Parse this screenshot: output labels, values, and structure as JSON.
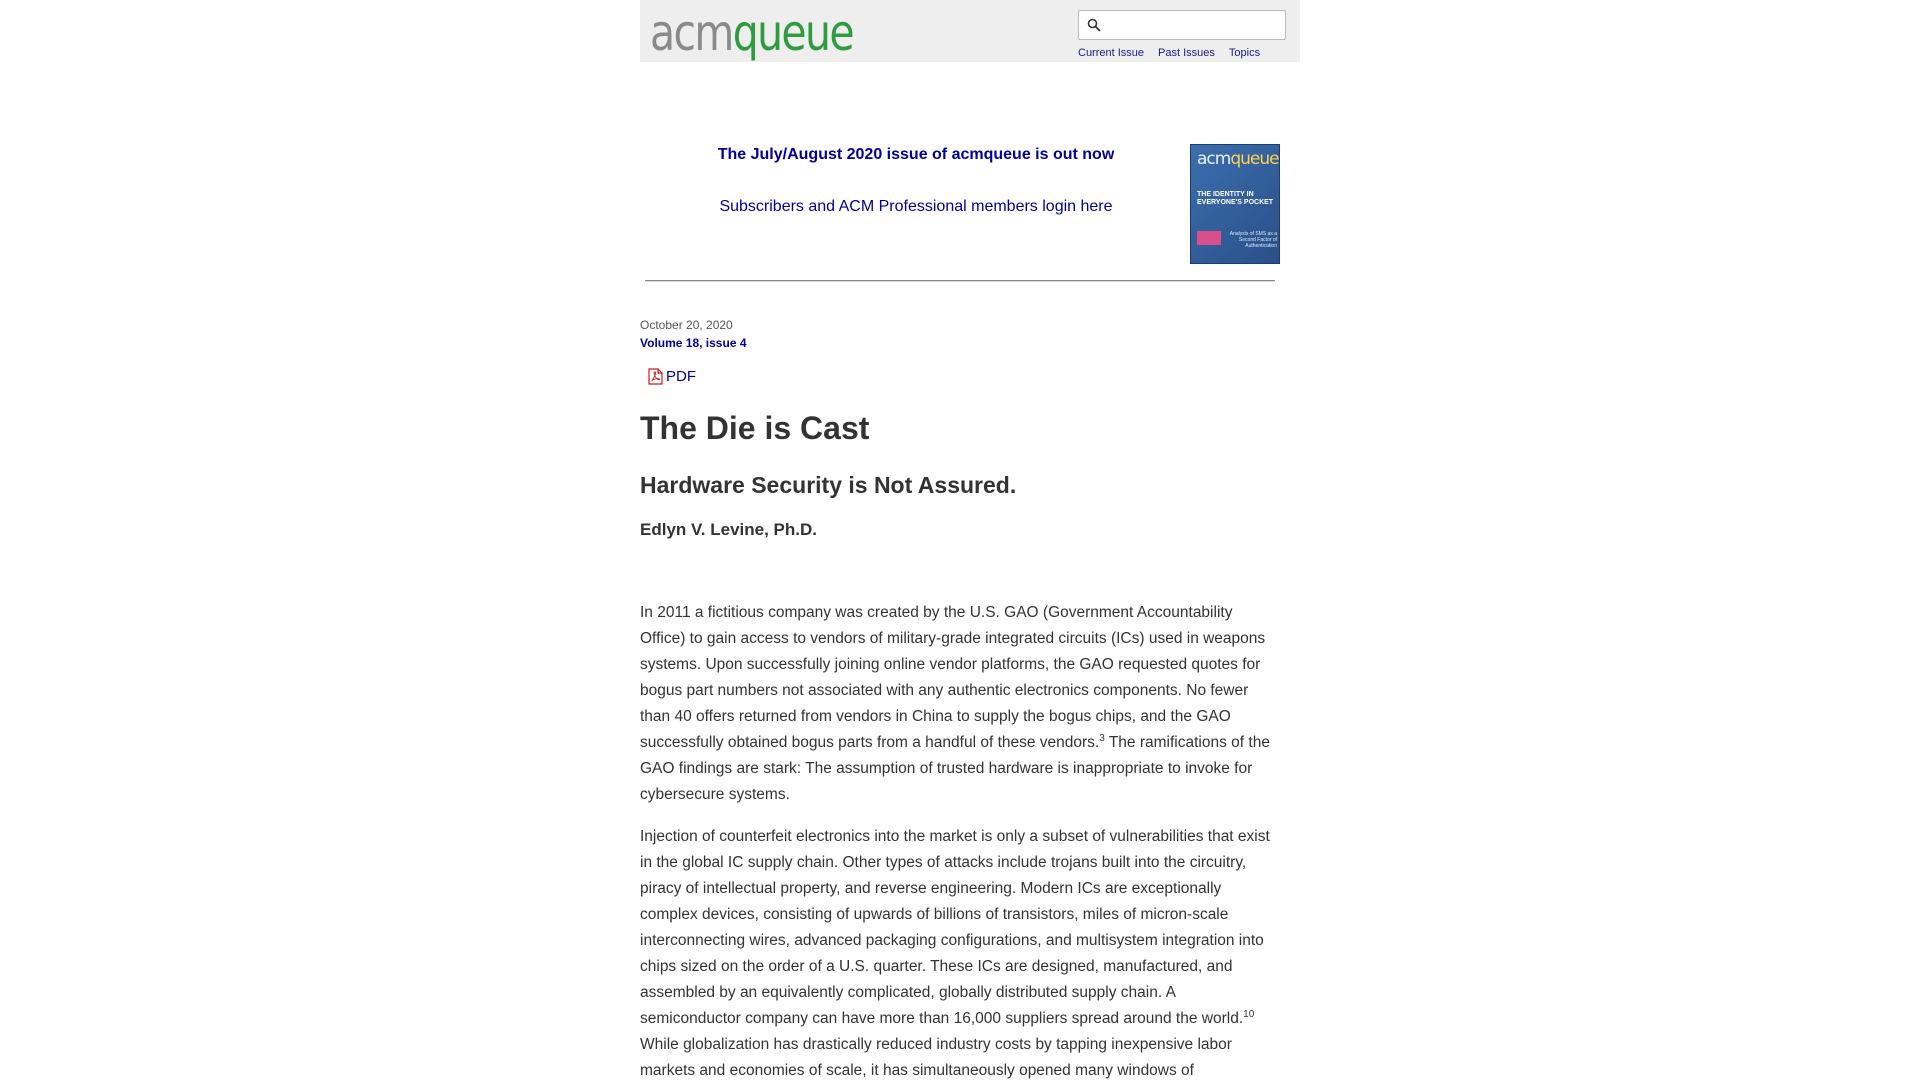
{
  "header": {
    "logo": {
      "acm": "acm",
      "queue": "queue"
    },
    "search": {
      "value": "",
      "placeholder": ""
    },
    "nav": [
      {
        "label": "Current Issue"
      },
      {
        "label": "Past Issues"
      },
      {
        "label": "Topics"
      }
    ]
  },
  "announcement": {
    "title": "The July/August 2020 issue of acmqueue is out now",
    "login": "Subscribers and ACM Professional members login here",
    "cover": {
      "logo_acm": "acm",
      "logo_queue": "queue",
      "headline": "THE IDENTITY IN EVERYONE'S POCKET",
      "subhead": "Analysis of SMS as a Second Factor of Authentication"
    }
  },
  "article": {
    "date": "October 20, 2020",
    "volume": "Volume 18, issue 4",
    "pdf_label": "PDF",
    "title": "The Die is Cast",
    "subtitle": "Hardware Security is Not Assured.",
    "author": "Edlyn V. Levine, Ph.D.",
    "paragraphs": [
      {
        "before": "In 2011 a fictitious company was created by the U.S. GAO (Government Accountability Office) to gain access to vendors of military-grade integrated circuits (ICs) used in weapons systems. Upon successfully joining online vendor platforms, the GAO requested quotes for bogus part numbers not associated with any authentic electronics components. No fewer than 40 offers returned from vendors in China to supply the bogus chips, and the GAO successfully obtained bogus parts from a handful of these vendors.",
        "sup": "3",
        "after": " The ramifications of the GAO findings are stark: The assumption of trusted hardware is inappropriate to invoke for cybersecure systems."
      },
      {
        "before": "Injection of counterfeit electronics into the market is only a subset of vulnerabilities that exist in the global IC supply chain. Other types of attacks include trojans built into the circuitry, piracy of intellectual property, and reverse engineering. Modern ICs are exceptionally complex devices, consisting of upwards of billions of transistors, miles of micron-scale interconnecting wires, advanced packaging configurations, and multisystem integration into chips sized on the order of a U.S. quarter. These ICs are designed, manufactured, and assembled by an equivalently complicated, globally distributed supply chain. A semiconductor company can have more than 16,000 suppliers spread around the world.",
        "sup": "10",
        "after": " While globalization has drastically reduced industry costs by tapping inexpensive labor markets and economies of scale, it has simultaneously opened many windows of"
      }
    ]
  },
  "colors": {
    "link": "#000099",
    "logo_gray": "#8a8a8a",
    "logo_green": "#2f9a3e",
    "header_bg": "#eeeeee",
    "text": "#333333"
  }
}
